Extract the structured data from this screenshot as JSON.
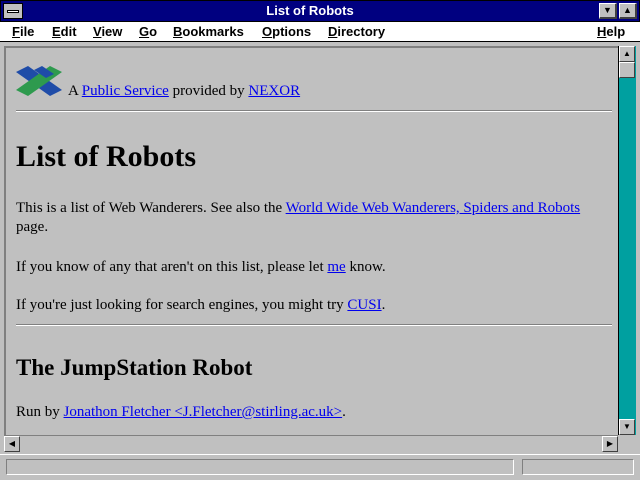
{
  "window": {
    "title": "List of Robots",
    "buttons": {
      "minimize": "▼",
      "maximize": "▲"
    }
  },
  "menubar": {
    "items": [
      {
        "label": "File",
        "mnemonic": "F"
      },
      {
        "label": "Edit",
        "mnemonic": "E"
      },
      {
        "label": "View",
        "mnemonic": "V"
      },
      {
        "label": "Go",
        "mnemonic": "G"
      },
      {
        "label": "Bookmarks",
        "mnemonic": "B"
      },
      {
        "label": "Options",
        "mnemonic": "O"
      },
      {
        "label": "Directory",
        "mnemonic": "D"
      },
      {
        "label": "Help",
        "mnemonic": "H"
      }
    ]
  },
  "page": {
    "header": {
      "prefix": "A ",
      "link1": "Public Service",
      "middle": " provided by ",
      "link2": "NEXOR"
    },
    "h1": "List of Robots",
    "intro": {
      "text1": "This is a list of Web Wanderers. See also the ",
      "link": "World Wide Web Wanderers, Spiders and Robots",
      "text2": "page."
    },
    "know": {
      "text1": "If you know of any that aren't on this list, please let ",
      "link": "me",
      "text2": " know."
    },
    "search": {
      "text1": "If you're just looking for search engines, you might try ",
      "link": "CUSI",
      "text2": "."
    },
    "h2": "The JumpStation Robot",
    "runby": {
      "text1": "Run by ",
      "link": "Jonathon Fletcher <J.Fletcher@stirling.ac.uk>",
      "text2": "."
    }
  },
  "colors": {
    "titlebar": "#000080",
    "link": "#0000ee",
    "scroll_track": "#00a0a0",
    "logo_blue": "#1f4ca8",
    "logo_green": "#2e9a4e"
  }
}
